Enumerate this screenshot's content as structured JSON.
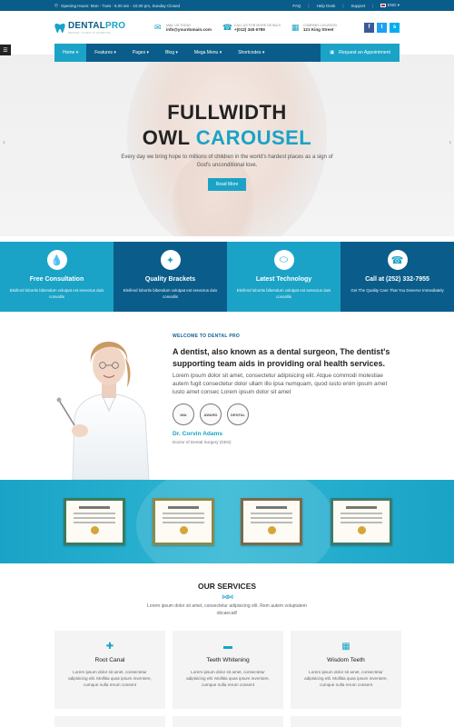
{
  "topbar": {
    "hours": "Opening Hours: Mon - Tues : 6.00 am - 10.00 pm, Sunday Closed",
    "links": [
      "FAQ",
      "Help Desk",
      "Support"
    ],
    "language": "ENG"
  },
  "header": {
    "logo_main": "DENTAL",
    "logo_accent": "PRO",
    "logo_tagline": "DENTAL CLINIC & HOSPITAL",
    "contacts": [
      {
        "icon": "envelope-icon",
        "label": "MAIL US TODAY",
        "value": "info@yourdomain.com"
      },
      {
        "icon": "phone-icon",
        "label": "CALL US FOR MORE DETAILS",
        "value": "+(012) 345 6789"
      },
      {
        "icon": "building-icon",
        "label": "COMPANY LOCATION",
        "value": "121 King Street"
      }
    ],
    "social": [
      {
        "name": "facebook",
        "glyph": "f",
        "color": "#3b5998"
      },
      {
        "name": "twitter",
        "glyph": "t",
        "color": "#1da1f2"
      },
      {
        "name": "skype",
        "glyph": "s",
        "color": "#00aff0"
      }
    ]
  },
  "nav": {
    "items": [
      "Home",
      "Features",
      "Pages",
      "Blog",
      "Mega Menu",
      "Shortcodes"
    ],
    "cta": "Request an Appointment"
  },
  "hero": {
    "title_line1": "FULLWIDTH",
    "title_line2_plain": "OWL",
    "title_line2_accent": "CAROUSEL",
    "subtitle": "Every day we bring hope to millions of children in the world's hardest places as a sign of God's unconditional love.",
    "button": "Read More"
  },
  "features": [
    {
      "icon": "drop-icon",
      "title": "Free Consultation",
      "desc": "Eleifend lobortis bibendum volutpat est senectus duis convallis",
      "bg": "#1aa3c6"
    },
    {
      "icon": "brackets-icon",
      "title": "Quality Brackets",
      "desc": "Eleifend lobortis bibendum volutpat est senectus duis convallis",
      "bg": "#0a5d8a"
    },
    {
      "icon": "pill-icon",
      "title": "Latest Technology",
      "desc": "Eleifend lobortis bibendum volutpat est senectus duis convallis",
      "bg": "#1aa3c6"
    },
    {
      "icon": "phone-icon",
      "title": "Call at (252) 332-7955",
      "desc": "Get The Quality Care That You Deserve Immediately",
      "bg": "#0a5d8a"
    }
  ],
  "about": {
    "welcome": "WELCOME TO DENTAL PRO",
    "heading": "A dentist, also known as a dental surgeon, The dentist's supporting team aids in providing oral health services.",
    "body": "Lorem ipsum dolor sit amet, consectetur adipisicing elit. Atque commodi molestiae autem fugit consectetur dolor ullam illo ipsa numquam, quod iusto enim ipsum amet iusto amet consec Lorem ipsum dolor sit amet",
    "badges": [
      "IMA",
      "AWARD",
      "DENTAL"
    ],
    "doctor_name": "Dr. Corvin Adams",
    "doctor_role": "Doctor of Dental Surgery (DDS)"
  },
  "certificates": {
    "count": 4
  },
  "services": {
    "title": "OUR SERVICES",
    "subtitle": "Lorem ipsum dolor sit amet, consectetur adipisicing elit. Rem autem voluptatem obcaecati!",
    "items": [
      {
        "icon": "first-aid-icon",
        "name": "Root Canal",
        "desc": "Lorem ipsum dolor sit amet, consectetur adipisicing elit. Mollitia quas ipsum inventore, cumque nulla rerum consent"
      },
      {
        "icon": "whitening-icon",
        "name": "Teeth Whitening",
        "desc": "Lorem ipsum dolor sit amet, consectetur adipisicing elit. Mollitia quas ipsum inventore, cumque nulla rerum consent"
      },
      {
        "icon": "hospital-icon",
        "name": "Wisdom Teeth",
        "desc": "Lorem ipsum dolor sit amet, consectetur adipisicing elit. Mollitia quas ipsum inventore, cumque nulla rerum consent"
      }
    ]
  }
}
